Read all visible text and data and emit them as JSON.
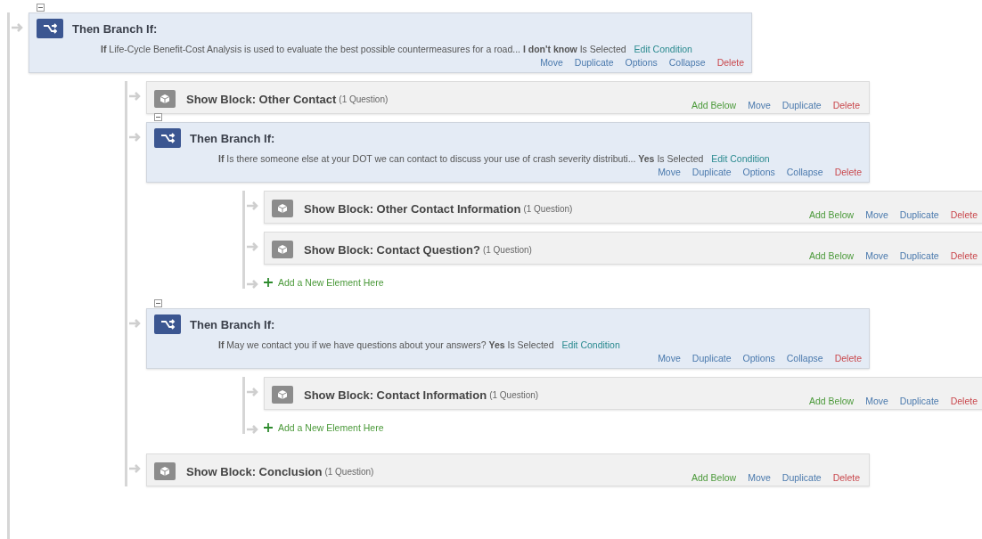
{
  "flow": [
    {
      "kind": "branch",
      "expanded": true,
      "title": "Then Branch If:",
      "condition": "**If** Life-Cycle Benefit-Cost Analysis is used to evaluate the best possible countermeasures for a road... **I don't know** Is Selected",
      "edit": "Edit Condition",
      "actions": [
        {
          "label": "Move",
          "kind": "move"
        },
        {
          "label": "Duplicate",
          "kind": "duplicate"
        },
        {
          "label": "Options",
          "kind": "options"
        },
        {
          "label": "Collapse",
          "kind": "collapse"
        },
        {
          "label": "Delete",
          "kind": "delete"
        }
      ],
      "children": [
        {
          "kind": "block",
          "title": "Show Block: Other Contact",
          "count": "(1 Question)",
          "actions": [
            {
              "label": "Add Below",
              "kind": "add"
            },
            {
              "label": "Move",
              "kind": "move"
            },
            {
              "label": "Duplicate",
              "kind": "duplicate"
            },
            {
              "label": "Delete",
              "kind": "delete"
            }
          ]
        },
        {
          "kind": "branch",
          "expanded": true,
          "title": "Then Branch If:",
          "condition": "**If** Is there someone else at your DOT we can contact to discuss your use of crash severity distributi... **Yes** Is Selected",
          "edit": "Edit Condition",
          "actions": [
            {
              "label": "Move",
              "kind": "move"
            },
            {
              "label": "Duplicate",
              "kind": "duplicate"
            },
            {
              "label": "Options",
              "kind": "options"
            },
            {
              "label": "Collapse",
              "kind": "collapse"
            },
            {
              "label": "Delete",
              "kind": "delete"
            }
          ],
          "children": [
            {
              "kind": "block",
              "title": "Show Block: Other Contact Information",
              "count": "(1 Question)",
              "actions": [
                {
                  "label": "Add Below",
                  "kind": "add"
                },
                {
                  "label": "Move",
                  "kind": "move"
                },
                {
                  "label": "Duplicate",
                  "kind": "duplicate"
                },
                {
                  "label": "Delete",
                  "kind": "delete"
                }
              ]
            },
            {
              "kind": "block",
              "title": "Show Block: Contact Question?",
              "count": "(1 Question)",
              "actions": [
                {
                  "label": "Add Below",
                  "kind": "add"
                },
                {
                  "label": "Move",
                  "kind": "move"
                },
                {
                  "label": "Duplicate",
                  "kind": "duplicate"
                },
                {
                  "label": "Delete",
                  "kind": "delete"
                }
              ]
            },
            {
              "kind": "add",
              "label": "Add a New Element Here"
            }
          ]
        },
        {
          "kind": "branch",
          "expanded": true,
          "title": "Then Branch If:",
          "condition": "**If** May we contact you if we have questions about your answers? **Yes** Is Selected",
          "edit": "Edit Condition",
          "actions": [
            {
              "label": "Move",
              "kind": "move"
            },
            {
              "label": "Duplicate",
              "kind": "duplicate"
            },
            {
              "label": "Options",
              "kind": "options"
            },
            {
              "label": "Collapse",
              "kind": "collapse"
            },
            {
              "label": "Delete",
              "kind": "delete"
            }
          ],
          "children": [
            {
              "kind": "block",
              "title": "Show Block: Contact Information",
              "count": "(1 Question)",
              "actions": [
                {
                  "label": "Add Below",
                  "kind": "add"
                },
                {
                  "label": "Move",
                  "kind": "move"
                },
                {
                  "label": "Duplicate",
                  "kind": "duplicate"
                },
                {
                  "label": "Delete",
                  "kind": "delete"
                }
              ]
            },
            {
              "kind": "add",
              "label": "Add a New Element Here"
            }
          ]
        },
        {
          "kind": "block",
          "title": "Show Block: Conclusion",
          "count": "(1 Question)",
          "actions": [
            {
              "label": "Add Below",
              "kind": "add"
            },
            {
              "label": "Move",
              "kind": "move"
            },
            {
              "label": "Duplicate",
              "kind": "duplicate"
            },
            {
              "label": "Delete",
              "kind": "delete"
            }
          ]
        }
      ]
    }
  ]
}
